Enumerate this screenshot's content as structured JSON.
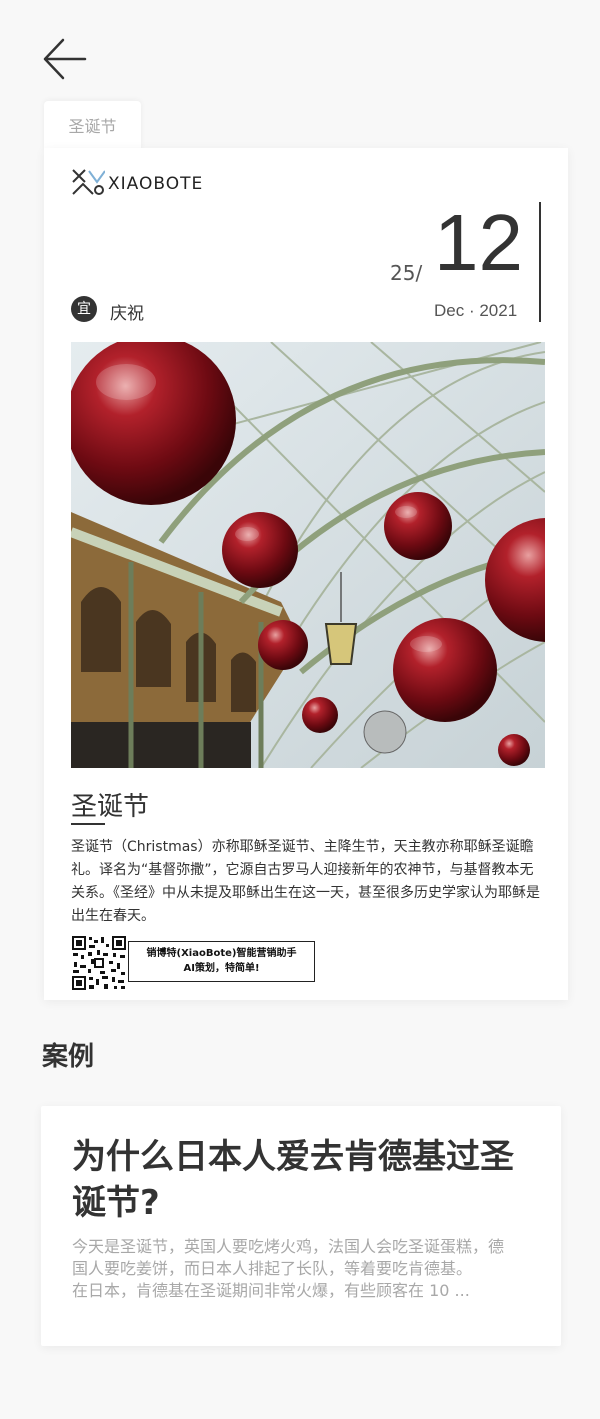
{
  "tab": {
    "label": "圣诞节"
  },
  "poster": {
    "brand": "XIAOBOTE",
    "date_day": "25/",
    "date_big": "12",
    "date_month": "Dec · 2021",
    "yi_badge": "宜",
    "yi_text": "庆祝",
    "title": "圣诞节",
    "description": "圣诞节（Christmas）亦称耶稣圣诞节、主降生节，天主教亦称耶稣圣诞瞻礼。译名为“基督弥撒”，它源自古罗马人迎接新年的农神节，与基督教本无关系。《圣经》中从未提及耶稣出生在这一天，甚至很多历史学家认为耶稣是出生在春天。",
    "promo_line1": "销博特(XiaoBote)智能营销助手",
    "promo_line2": "AI策划，特简单!"
  },
  "section": {
    "title": "案例"
  },
  "case": {
    "title": "为什么日本人爱去肯德基过圣诞节?",
    "body_line1": "今天是圣诞节，英国人要吃烤火鸡，法国人会吃圣诞蛋糕，德国人要吃姜饼，而日本人排起了长队，等着要吃肯德基。",
    "body_line2": "在日本，肯德基在圣诞期间非常火爆，有些顾客在 10 ..."
  },
  "colors": {
    "ornament": "#8b0d16",
    "ironwork": "#9aab8c",
    "text": "#333333"
  }
}
